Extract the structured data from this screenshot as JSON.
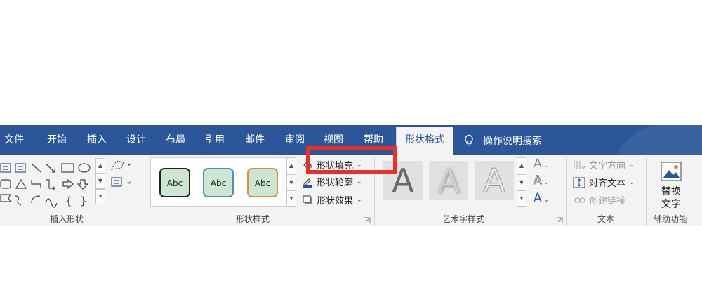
{
  "tabs": {
    "file": "文件",
    "home": "开始",
    "insert": "插入",
    "design": "设计",
    "layout": "布局",
    "references": "引用",
    "mailings": "邮件",
    "review": "审阅",
    "view": "视图",
    "help": "帮助",
    "shape_format": "形状格式",
    "tell_me": "操作说明搜索"
  },
  "groups": {
    "insert_shapes": "插入形状",
    "shape_styles": "形状样式",
    "wordart_styles": "艺术字样式",
    "text": "文本",
    "accessibility": "辅助功能"
  },
  "shape_styles": {
    "presets": [
      "Abc",
      "Abc",
      "Abc"
    ],
    "fill": "形状填充",
    "outline": "形状轮廓",
    "effects": "形状效果"
  },
  "wordart": {
    "letter": "A"
  },
  "text_group": {
    "direction": "文字方向",
    "align": "对齐文本",
    "link": "创建链接"
  },
  "accessibility": {
    "alt_text_line1": "替换",
    "alt_text_line2": "文字"
  },
  "colors": {
    "tabbar": "#2b579a",
    "ribbon": "#f3f3f3",
    "highlight": "#e8302a"
  }
}
